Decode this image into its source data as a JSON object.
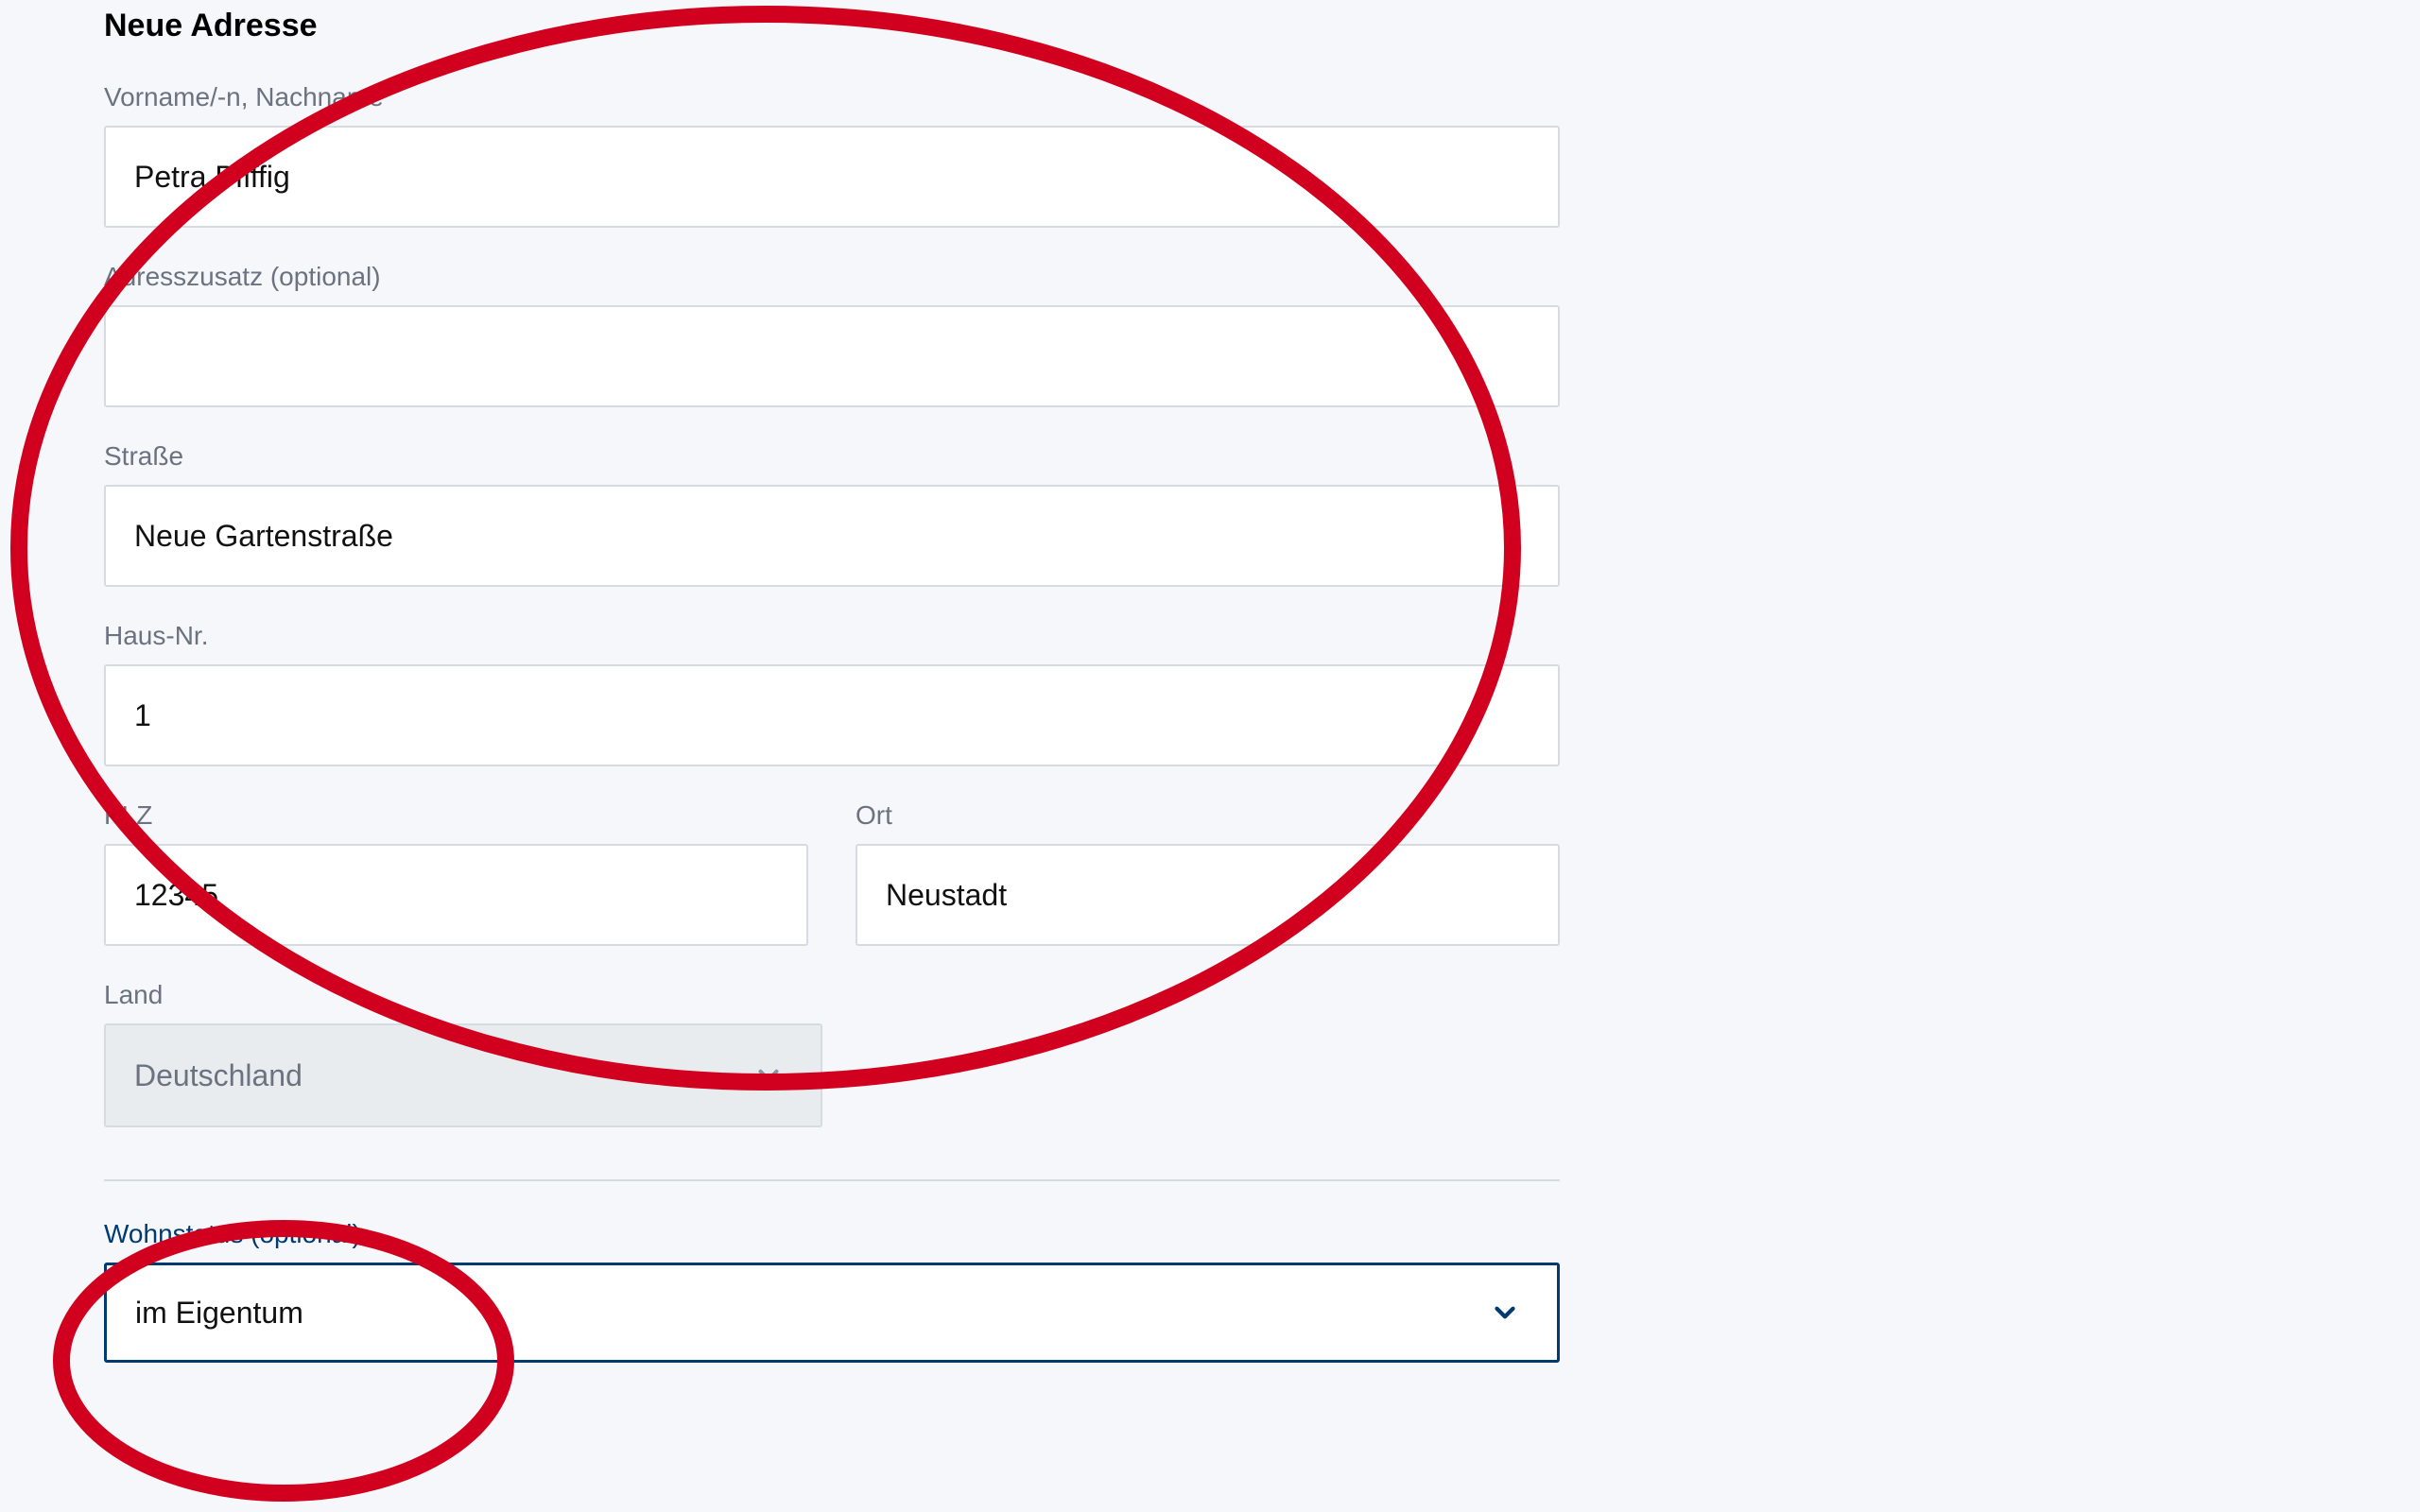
{
  "section_title": "Neue Adresse",
  "fields": {
    "name": {
      "label": "Vorname/-n, Nachname",
      "value": "Petra Pfiffig"
    },
    "addon": {
      "label": "Adresszusatz (optional)",
      "value": ""
    },
    "street": {
      "label": "Straße",
      "value": "Neue Gartenstraße"
    },
    "house": {
      "label": "Haus-Nr.",
      "value": "1"
    },
    "zip": {
      "label": "PLZ",
      "value": "12345"
    },
    "city": {
      "label": "Ort",
      "value": "Neustadt"
    },
    "country": {
      "label": "Land",
      "value": "Deutschland"
    },
    "wohnstatus": {
      "label": "Wohnstatus (optional)",
      "value": "im Eigentum"
    }
  }
}
